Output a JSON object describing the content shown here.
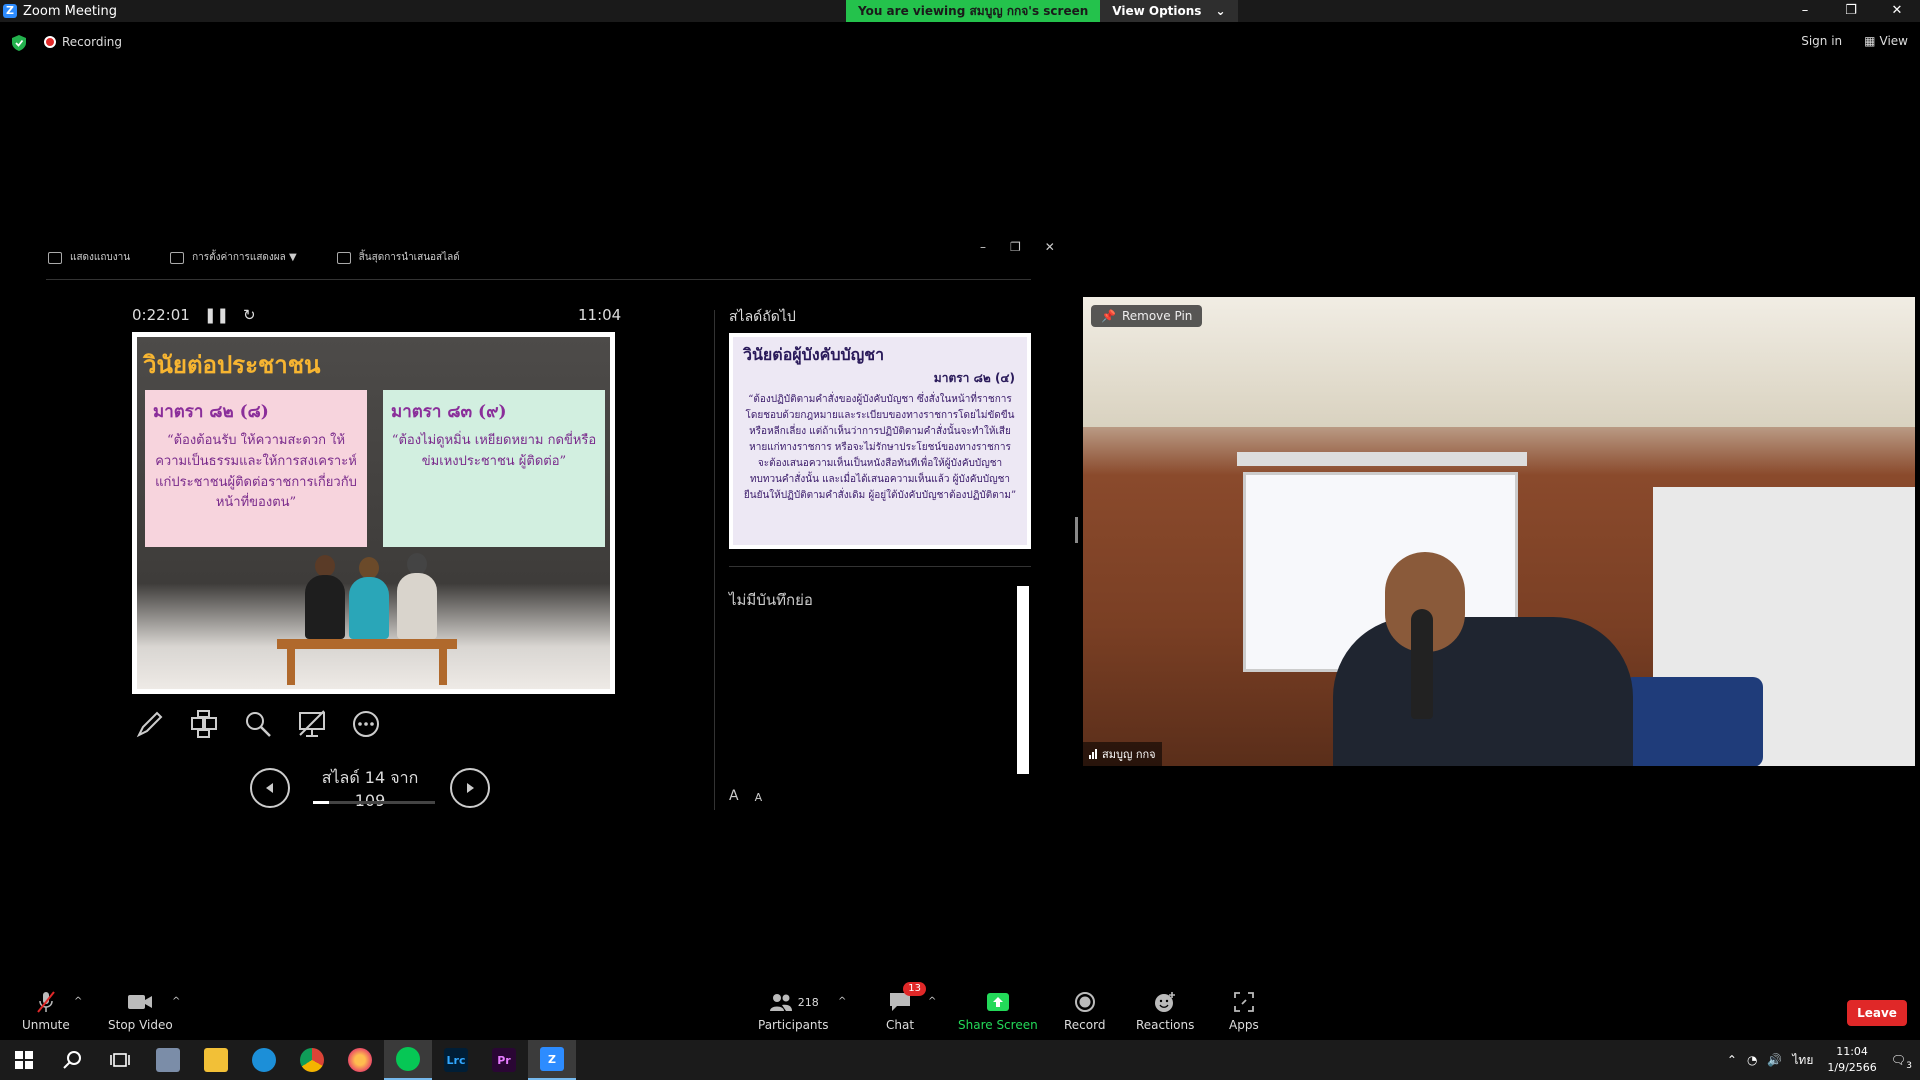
{
  "window": {
    "title": "Zoom Meeting",
    "viewing_banner": "You are viewing สมบูญ กกจ's screen",
    "view_options": "View Options",
    "minimize": "–",
    "restore": "❐",
    "close": "✕"
  },
  "meeting": {
    "recording_label": "Recording",
    "sign_in": "Sign in",
    "view": "View"
  },
  "presenter_view": {
    "toolbar": [
      "แสดงแถบงาน",
      "การตั้งค่าการแสดงผล ▼",
      "สิ้นสุดการนำเสนอสไลด์"
    ],
    "elapsed": "0:22:01",
    "clock": "11:04",
    "slide_counter": "สไลด์ 14 จาก 109",
    "progress_fraction": 0.128,
    "next_slide_label": "สไลด์ถัดไป",
    "notes_text": "ไม่มีบันทึกย่อ",
    "font_increase": "A",
    "font_decrease": "A"
  },
  "current_slide": {
    "title": "วินัยต่อประชาชน",
    "box1_heading": "มาตรา ๘๒ (๘)",
    "box1_text": "“ต้องต้อนรับ ให้ความสะดวก ให้ความเป็นธรรมและให้การสงเคราะห์แก่ประชาชนผู้ติดต่อราชการเกี่ยวกับหน้าที่ของตน”",
    "box2_heading": "มาตรา ๘๓ (๙)",
    "box2_text": "“ต้องไม่ดูหมิ่น เหยียดหยาม กดขี่หรือข่มเหงประชาชน ผู้ติดต่อ”"
  },
  "next_slide": {
    "title": "วินัยต่อผู้บังคับบัญชา",
    "subtitle": "มาตรา ๘๒ (๔)",
    "body": "“ต้องปฏิบัติตามคำสั่งของผู้บังคับบัญชา ซึ่งสั่งในหน้าที่ราชการโดยชอบด้วยกฎหมายและระเบียบของทางราชการโดยไม่ขัดขืนหรือหลีกเลี่ยง แต่ถ้าเห็นว่าการปฏิบัติตามคำสั่งนั้นจะทำให้เสียหายแก่ทางราชการ หรือจะไม่รักษาประโยชน์ของทางราชการ จะต้องเสนอความเห็นเป็นหนังสือทันทีเพื่อให้ผู้บังคับบัญชาทบทวนคำสั่งนั้น และเมื่อได้เสนอความเห็นแล้ว ผู้บังคับบัญชายืนยันให้ปฏิบัติตามคำสั่งเดิม ผู้อยู่ใต้บังคับบัญชาต้องปฏิบัติตาม”"
  },
  "video": {
    "remove_pin": "Remove Pin",
    "participant_name": "สมบูญ กกจ"
  },
  "toolbar": {
    "unmute": "Unmute",
    "stop_video": "Stop Video",
    "participants": "Participants",
    "participant_count": "218",
    "chat": "Chat",
    "chat_badge": "13",
    "share_screen": "Share Screen",
    "record": "Record",
    "reactions": "Reactions",
    "apps": "Apps",
    "leave": "Leave"
  },
  "taskbar": {
    "lrc": "Lrc",
    "pr": "Pr",
    "lang": "ไทย",
    "time": "11:04",
    "date": "1/9/2566",
    "notif_count": "3"
  },
  "colors": {
    "green_banner": "#24c24c",
    "leave_red": "#e02828",
    "share_green": "#23d959",
    "slide_title": "#f7b531"
  }
}
